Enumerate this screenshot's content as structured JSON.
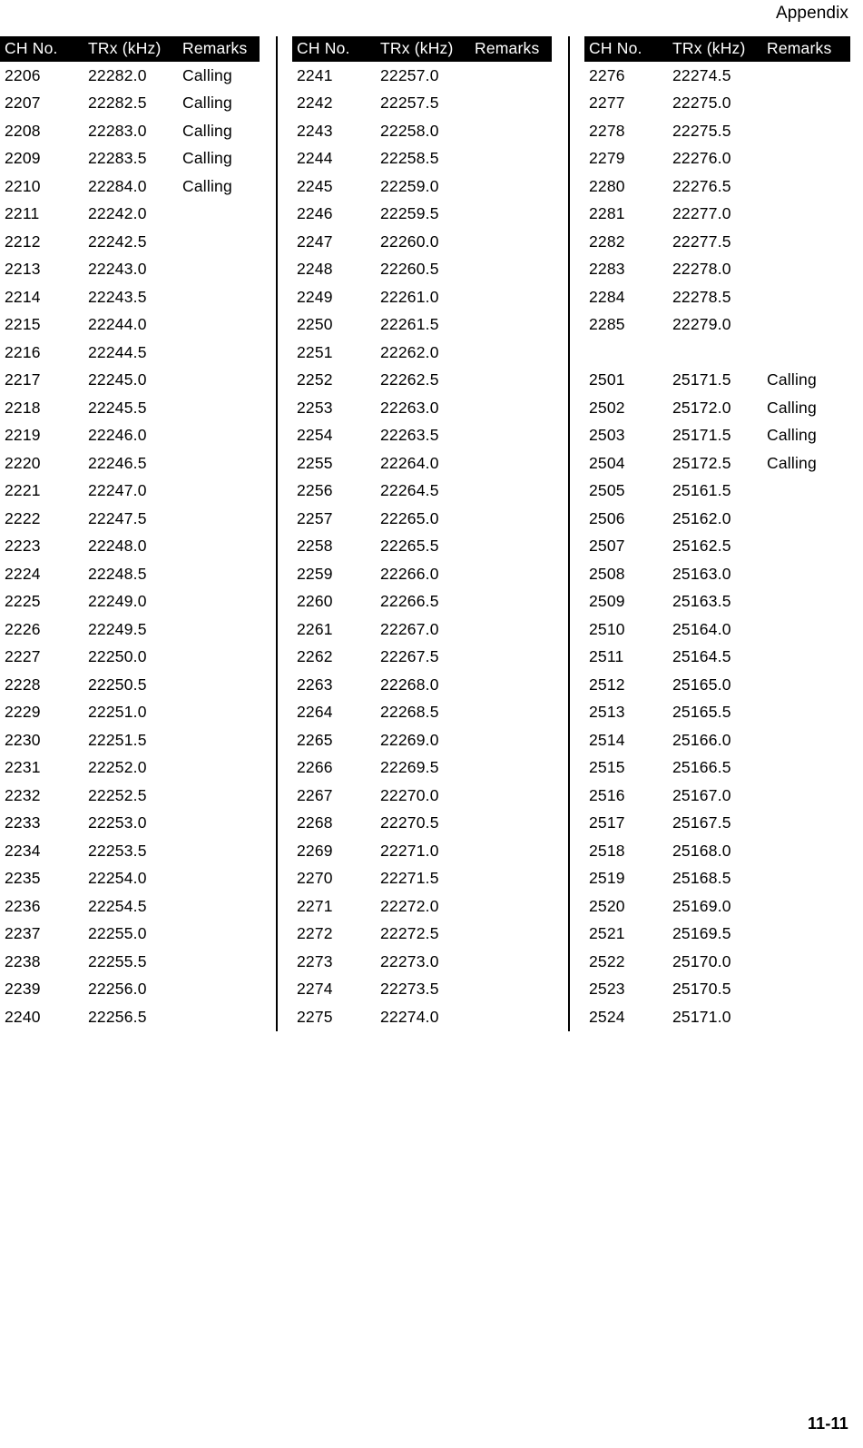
{
  "header": {
    "running_head": "Appendix"
  },
  "footer": {
    "page_number": "11-11"
  },
  "columns": [
    {
      "id": "column-1",
      "headers": {
        "ch_no": "CH No.",
        "trx": "TRx (kHz)",
        "remarks": "Remarks"
      },
      "rows": [
        {
          "ch": "2206",
          "trx": "22282.0",
          "remarks": "Calling"
        },
        {
          "ch": "2207",
          "trx": "22282.5",
          "remarks": "Calling"
        },
        {
          "ch": "2208",
          "trx": "22283.0",
          "remarks": "Calling"
        },
        {
          "ch": "2209",
          "trx": "22283.5",
          "remarks": "Calling"
        },
        {
          "ch": "2210",
          "trx": "22284.0",
          "remarks": "Calling"
        },
        {
          "ch": "2211",
          "trx": "22242.0",
          "remarks": ""
        },
        {
          "ch": "2212",
          "trx": "22242.5",
          "remarks": ""
        },
        {
          "ch": "2213",
          "trx": "22243.0",
          "remarks": ""
        },
        {
          "ch": "2214",
          "trx": "22243.5",
          "remarks": ""
        },
        {
          "ch": "2215",
          "trx": "22244.0",
          "remarks": ""
        },
        {
          "ch": "2216",
          "trx": "22244.5",
          "remarks": ""
        },
        {
          "ch": "2217",
          "trx": "22245.0",
          "remarks": ""
        },
        {
          "ch": "2218",
          "trx": "22245.5",
          "remarks": ""
        },
        {
          "ch": "2219",
          "trx": "22246.0",
          "remarks": ""
        },
        {
          "ch": "2220",
          "trx": "22246.5",
          "remarks": ""
        },
        {
          "ch": "2221",
          "trx": "22247.0",
          "remarks": ""
        },
        {
          "ch": "2222",
          "trx": "22247.5",
          "remarks": ""
        },
        {
          "ch": "2223",
          "trx": "22248.0",
          "remarks": ""
        },
        {
          "ch": "2224",
          "trx": "22248.5",
          "remarks": ""
        },
        {
          "ch": "2225",
          "trx": "22249.0",
          "remarks": ""
        },
        {
          "ch": "2226",
          "trx": "22249.5",
          "remarks": ""
        },
        {
          "ch": "2227",
          "trx": "22250.0",
          "remarks": ""
        },
        {
          "ch": "2228",
          "trx": "22250.5",
          "remarks": ""
        },
        {
          "ch": "2229",
          "trx": "22251.0",
          "remarks": ""
        },
        {
          "ch": "2230",
          "trx": "22251.5",
          "remarks": ""
        },
        {
          "ch": "2231",
          "trx": "22252.0",
          "remarks": ""
        },
        {
          "ch": "2232",
          "trx": "22252.5",
          "remarks": ""
        },
        {
          "ch": "2233",
          "trx": "22253.0",
          "remarks": ""
        },
        {
          "ch": "2234",
          "trx": "22253.5",
          "remarks": ""
        },
        {
          "ch": "2235",
          "trx": "22254.0",
          "remarks": ""
        },
        {
          "ch": "2236",
          "trx": "22254.5",
          "remarks": ""
        },
        {
          "ch": "2237",
          "trx": "22255.0",
          "remarks": ""
        },
        {
          "ch": "2238",
          "trx": "22255.5",
          "remarks": ""
        },
        {
          "ch": "2239",
          "trx": "22256.0",
          "remarks": ""
        },
        {
          "ch": "2240",
          "trx": "22256.5",
          "remarks": ""
        }
      ]
    },
    {
      "id": "column-2",
      "headers": {
        "ch_no": "CH No.",
        "trx": "TRx (kHz)",
        "remarks": "Remarks"
      },
      "rows": [
        {
          "ch": "2241",
          "trx": "22257.0",
          "remarks": ""
        },
        {
          "ch": "2242",
          "trx": "22257.5",
          "remarks": ""
        },
        {
          "ch": "2243",
          "trx": "22258.0",
          "remarks": ""
        },
        {
          "ch": "2244",
          "trx": "22258.5",
          "remarks": ""
        },
        {
          "ch": "2245",
          "trx": "22259.0",
          "remarks": ""
        },
        {
          "ch": "2246",
          "trx": "22259.5",
          "remarks": ""
        },
        {
          "ch": "2247",
          "trx": "22260.0",
          "remarks": ""
        },
        {
          "ch": "2248",
          "trx": "22260.5",
          "remarks": ""
        },
        {
          "ch": "2249",
          "trx": "22261.0",
          "remarks": ""
        },
        {
          "ch": "2250",
          "trx": "22261.5",
          "remarks": ""
        },
        {
          "ch": "2251",
          "trx": "22262.0",
          "remarks": ""
        },
        {
          "ch": "2252",
          "trx": "22262.5",
          "remarks": ""
        },
        {
          "ch": "2253",
          "trx": "22263.0",
          "remarks": ""
        },
        {
          "ch": "2254",
          "trx": "22263.5",
          "remarks": ""
        },
        {
          "ch": "2255",
          "trx": "22264.0",
          "remarks": ""
        },
        {
          "ch": "2256",
          "trx": "22264.5",
          "remarks": ""
        },
        {
          "ch": "2257",
          "trx": "22265.0",
          "remarks": ""
        },
        {
          "ch": "2258",
          "trx": "22265.5",
          "remarks": ""
        },
        {
          "ch": "2259",
          "trx": "22266.0",
          "remarks": ""
        },
        {
          "ch": "2260",
          "trx": "22266.5",
          "remarks": ""
        },
        {
          "ch": "2261",
          "trx": "22267.0",
          "remarks": ""
        },
        {
          "ch": "2262",
          "trx": "22267.5",
          "remarks": ""
        },
        {
          "ch": "2263",
          "trx": "22268.0",
          "remarks": ""
        },
        {
          "ch": "2264",
          "trx": "22268.5",
          "remarks": ""
        },
        {
          "ch": "2265",
          "trx": "22269.0",
          "remarks": ""
        },
        {
          "ch": "2266",
          "trx": "22269.5",
          "remarks": ""
        },
        {
          "ch": "2267",
          "trx": "22270.0",
          "remarks": ""
        },
        {
          "ch": "2268",
          "trx": "22270.5",
          "remarks": ""
        },
        {
          "ch": "2269",
          "trx": "22271.0",
          "remarks": ""
        },
        {
          "ch": "2270",
          "trx": "22271.5",
          "remarks": ""
        },
        {
          "ch": "2271",
          "trx": "22272.0",
          "remarks": ""
        },
        {
          "ch": "2272",
          "trx": "22272.5",
          "remarks": ""
        },
        {
          "ch": "2273",
          "trx": "22273.0",
          "remarks": ""
        },
        {
          "ch": "2274",
          "trx": "22273.5",
          "remarks": ""
        },
        {
          "ch": "2275",
          "trx": "22274.0",
          "remarks": ""
        }
      ]
    },
    {
      "id": "column-3",
      "headers": {
        "ch_no": "CH No.",
        "trx": "TRx (kHz)",
        "remarks": "Remarks"
      },
      "rows": [
        {
          "ch": "2276",
          "trx": "22274.5",
          "remarks": ""
        },
        {
          "ch": "2277",
          "trx": "22275.0",
          "remarks": ""
        },
        {
          "ch": "2278",
          "trx": "22275.5",
          "remarks": ""
        },
        {
          "ch": "2279",
          "trx": "22276.0",
          "remarks": ""
        },
        {
          "ch": "2280",
          "trx": "22276.5",
          "remarks": ""
        },
        {
          "ch": "2281",
          "trx": "22277.0",
          "remarks": ""
        },
        {
          "ch": "2282",
          "trx": "22277.5",
          "remarks": ""
        },
        {
          "ch": "2283",
          "trx": "22278.0",
          "remarks": ""
        },
        {
          "ch": "2284",
          "trx": "22278.5",
          "remarks": ""
        },
        {
          "ch": "2285",
          "trx": "22279.0",
          "remarks": ""
        },
        {
          "spacer": true,
          "ch": "",
          "trx": "",
          "remarks": ""
        },
        {
          "ch": "2501",
          "trx": "25171.5",
          "remarks": "Calling"
        },
        {
          "ch": "2502",
          "trx": "25172.0",
          "remarks": "Calling"
        },
        {
          "ch": "2503",
          "trx": "25171.5",
          "remarks": "Calling"
        },
        {
          "ch": "2504",
          "trx": "25172.5",
          "remarks": "Calling"
        },
        {
          "ch": "2505",
          "trx": "25161.5",
          "remarks": ""
        },
        {
          "ch": "2506",
          "trx": "25162.0",
          "remarks": ""
        },
        {
          "ch": "2507",
          "trx": "25162.5",
          "remarks": ""
        },
        {
          "ch": "2508",
          "trx": "25163.0",
          "remarks": ""
        },
        {
          "ch": "2509",
          "trx": "25163.5",
          "remarks": ""
        },
        {
          "ch": "2510",
          "trx": "25164.0",
          "remarks": ""
        },
        {
          "ch": "2511",
          "trx": "25164.5",
          "remarks": ""
        },
        {
          "ch": "2512",
          "trx": "25165.0",
          "remarks": ""
        },
        {
          "ch": "2513",
          "trx": "25165.5",
          "remarks": ""
        },
        {
          "ch": "2514",
          "trx": "25166.0",
          "remarks": ""
        },
        {
          "ch": "2515",
          "trx": "25166.5",
          "remarks": ""
        },
        {
          "ch": "2516",
          "trx": "25167.0",
          "remarks": ""
        },
        {
          "ch": "2517",
          "trx": "25167.5",
          "remarks": ""
        },
        {
          "ch": "2518",
          "trx": "25168.0",
          "remarks": ""
        },
        {
          "ch": "2519",
          "trx": "25168.5",
          "remarks": ""
        },
        {
          "ch": "2520",
          "trx": "25169.0",
          "remarks": ""
        },
        {
          "ch": "2521",
          "trx": "25169.5",
          "remarks": ""
        },
        {
          "ch": "2522",
          "trx": "25170.0",
          "remarks": ""
        },
        {
          "ch": "2523",
          "trx": "25170.5",
          "remarks": ""
        },
        {
          "ch": "2524",
          "trx": "25171.0",
          "remarks": ""
        }
      ]
    }
  ]
}
